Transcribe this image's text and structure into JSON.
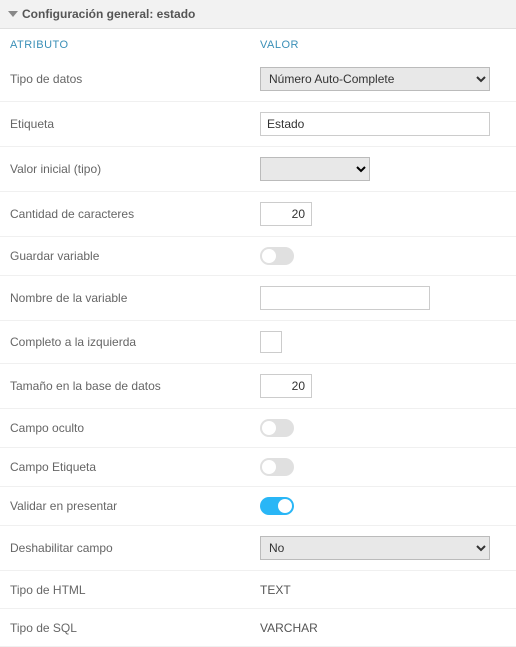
{
  "header": {
    "title": "Configuración general: estado"
  },
  "columns": {
    "attr": "ATRIBUTO",
    "val": "VALOR"
  },
  "rows": {
    "dataType": {
      "label": "Tipo de datos",
      "value": "Número Auto-Complete"
    },
    "etiqueta": {
      "label": "Etiqueta",
      "value": "Estado"
    },
    "valorInicial": {
      "label": "Valor inicial (tipo)",
      "value": ""
    },
    "cantidadChars": {
      "label": "Cantidad de caracteres",
      "value": "20"
    },
    "guardarVar": {
      "label": "Guardar variable",
      "on": false
    },
    "nombreVar": {
      "label": "Nombre de la variable",
      "value": ""
    },
    "completoIzq": {
      "label": "Completo a la izquierda"
    },
    "tamanoDb": {
      "label": "Tamaño en la base de datos",
      "value": "20"
    },
    "campoOculto": {
      "label": "Campo oculto",
      "on": false
    },
    "campoEtiqueta": {
      "label": "Campo Etiqueta",
      "on": false
    },
    "validarPresentar": {
      "label": "Validar en presentar",
      "on": true
    },
    "deshabilitar": {
      "label": "Deshabilitar campo",
      "value": "No"
    },
    "tipoHtml": {
      "label": "Tipo de HTML",
      "value": "TEXT"
    },
    "tipoSql": {
      "label": "Tipo de SQL",
      "value": "VARCHAR"
    }
  }
}
